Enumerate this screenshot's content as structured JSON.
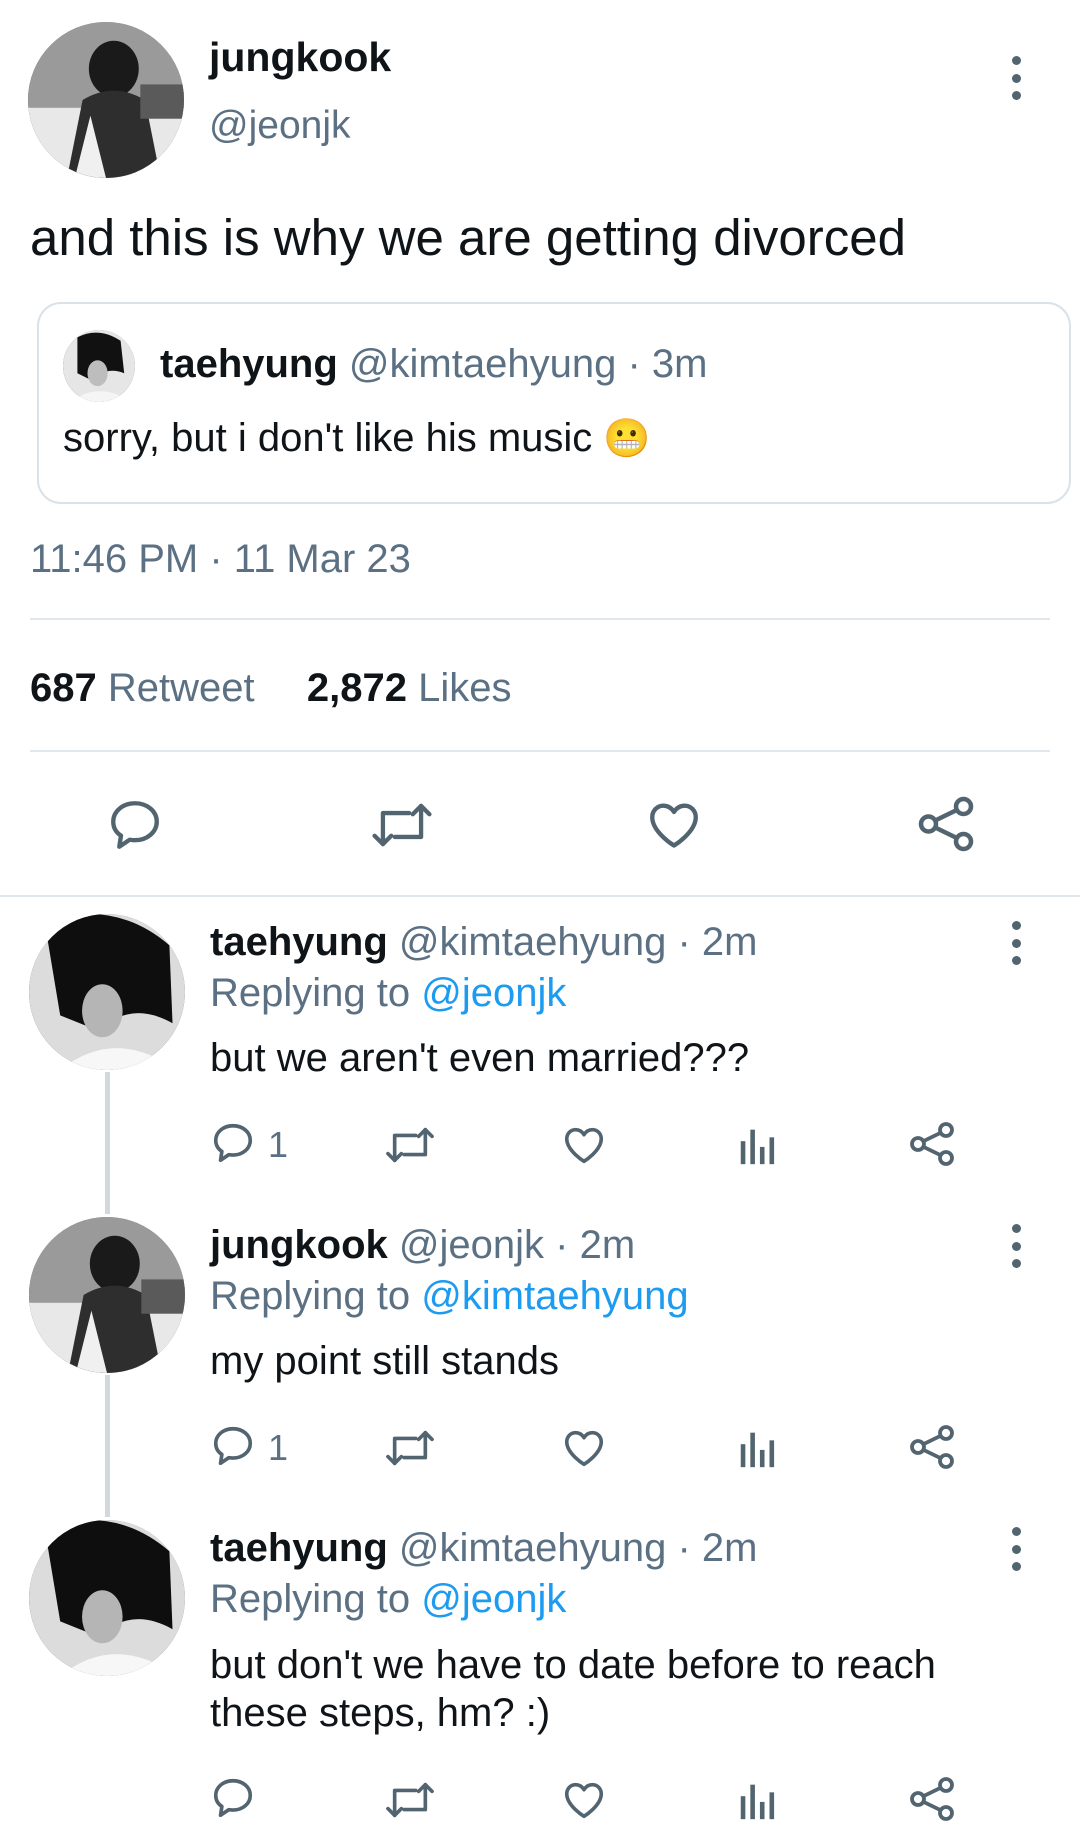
{
  "main_tweet": {
    "display_name": "jungkook",
    "handle": "@jeonjk",
    "text": "and this is why we are getting divorced",
    "quoted": {
      "display_name": "taehyung",
      "handle": "@kimtaehyung",
      "time": "· 3m",
      "text": "sorry, but i don't like his music",
      "emoji": "😬"
    },
    "timestamp": "11:46 PM · 11 Mar 23",
    "retweet_count": "687",
    "retweet_label": "Retweet",
    "likes_count": "2,872",
    "likes_label": "Likes"
  },
  "replies": [
    {
      "display_name": "taehyung",
      "handle": "@kimtaehyung",
      "time": "· 2m",
      "replying_prefix": "Replying to",
      "replying_to": "@jeonjk",
      "text": "but we aren't even married???",
      "reply_count": "1"
    },
    {
      "display_name": "jungkook",
      "handle": "@jeonjk",
      "time": "· 2m",
      "replying_prefix": "Replying to",
      "replying_to": "@kimtaehyung",
      "text": "my point still stands",
      "reply_count": "1"
    },
    {
      "display_name": "taehyung",
      "handle": "@kimtaehyung",
      "time": "· 2m",
      "replying_prefix": "Replying to",
      "replying_to": "@jeonjk",
      "text_line1": "but don't we have to date before to reach",
      "text_line2": "these steps, hm? :)",
      "reply_count": ""
    }
  ],
  "colors": {
    "text": "#0f1419",
    "muted": "#5b7083",
    "link": "#1d9bf0",
    "divider": "#e1e8ed",
    "icon": "#536471"
  },
  "icons": [
    "more-icon",
    "reply-icon",
    "retweet-icon",
    "like-icon",
    "share-icon",
    "analytics-icon"
  ]
}
